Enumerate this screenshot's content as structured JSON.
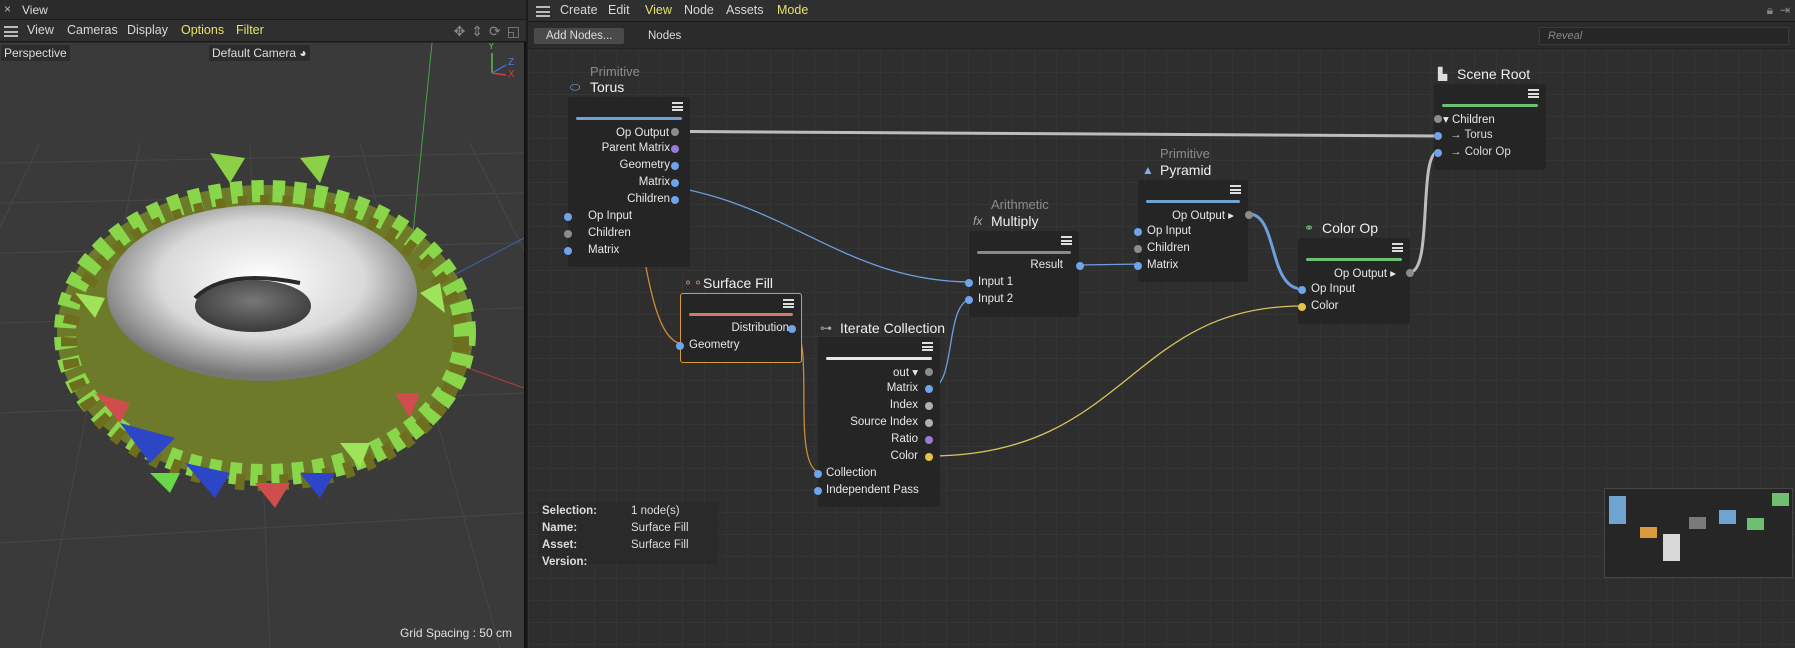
{
  "left_panel": {
    "title": "View",
    "close_glyph": "×",
    "menu": [
      "View",
      "Cameras",
      "Display",
      "Options",
      "Filter"
    ],
    "viewport_label": "Perspective",
    "camera_label": "Default Camera",
    "camera_icon": "◕",
    "grid_spacing": "Grid Spacing : 50 cm",
    "axis": {
      "x": "X",
      "y": "Y",
      "z": "Z"
    },
    "colors": {
      "x": "#d04040",
      "y": "#5bbf3a",
      "z": "#3c6fd0"
    }
  },
  "node_editor": {
    "menu": [
      "Create",
      "Edit",
      "View",
      "Node",
      "Assets",
      "Mode"
    ],
    "add_nodes_label": "Add Nodes...",
    "nodes_tab": "Nodes",
    "reveal_placeholder": "Reveal",
    "nodes": {
      "torus": {
        "category": "Primitive",
        "title": "Torus",
        "bar_color": "#6fa3d1",
        "outputs": [
          "Op Output ▾",
          "Parent Matrix",
          "Geometry",
          "Matrix",
          "Children"
        ],
        "inputs": [
          "Op Input",
          "Children",
          "Matrix"
        ]
      },
      "surface_fill": {
        "title": "Surface Fill",
        "bar_color": "#d07a6d",
        "outputs": [
          "Distribution"
        ],
        "inputs": [
          "Geometry"
        ]
      },
      "iterate_collection": {
        "title": "Iterate Collection",
        "bar_color": "#e6e6e6",
        "outputs": [
          "out ▾",
          "Matrix",
          "Index",
          "Source Index",
          "Ratio",
          "Color"
        ],
        "inputs": [
          "Collection",
          "Independent Pass"
        ]
      },
      "multiply": {
        "category": "Arithmetic",
        "title": "Multiply",
        "icon": "fx",
        "bar_color": "#8a8a8a",
        "outputs": [
          "Result"
        ],
        "inputs": [
          "Input 1",
          "Input 2"
        ]
      },
      "pyramid": {
        "category": "Primitive",
        "title": "Pyramid",
        "bar_color": "#6fa3d1",
        "outputs": [
          "Op Output ▸"
        ],
        "inputs": [
          "Op Input",
          "Children",
          "Matrix"
        ]
      },
      "color_op": {
        "title": "Color Op",
        "bar_color": "#6fbf72",
        "outputs": [
          "Op Output ▸"
        ],
        "inputs": [
          "Op Input",
          "Color"
        ]
      },
      "scene_root": {
        "title": "Scene Root",
        "bar_color": "#6fbf72",
        "inputs": [
          "▾ Children",
          "Torus",
          "Color Op"
        ]
      }
    },
    "info": {
      "selection_label": "Selection:",
      "selection_value": "1 node(s)",
      "name_label": "Name:",
      "name_value": "Surface Fill",
      "asset_label": "Asset:",
      "asset_value": "Surface Fill",
      "version_label": "Version:",
      "version_value": ""
    },
    "port_colors": {
      "op": "#8c8c8c",
      "matrix": "#6fa3ec",
      "geometry": "#6fa3ec",
      "parent_matrix": "#9a7ad8",
      "color": "#e6c44a",
      "index": "#b0b0b0"
    },
    "wire_colors": {
      "op": "#bdbdbd",
      "matrix": "#6f9ede",
      "geometry": "#c98a3a",
      "collection": "#c98a3a",
      "color": "#d9c35a"
    }
  }
}
